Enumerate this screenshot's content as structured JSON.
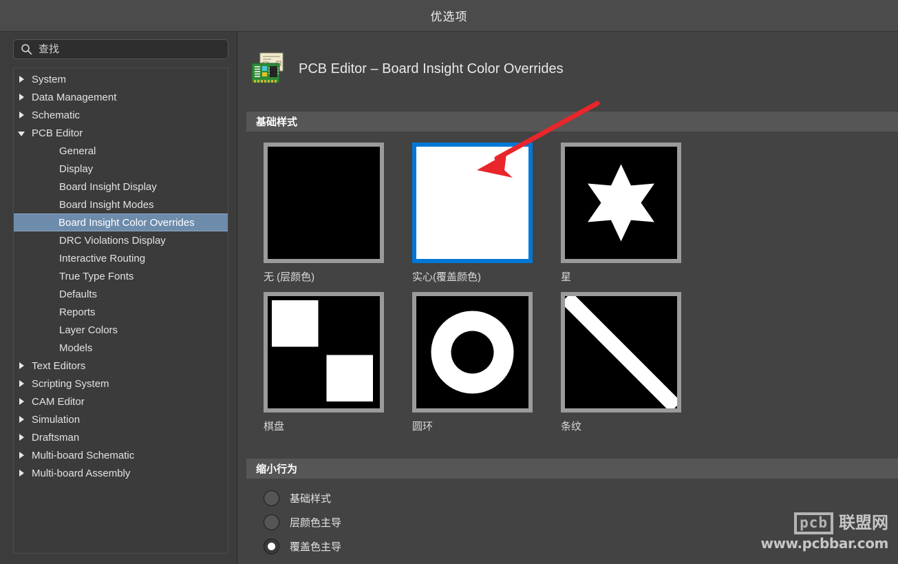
{
  "window": {
    "title": "优选项"
  },
  "search": {
    "icon": "search-icon",
    "value": "查找"
  },
  "sidebar": {
    "items": [
      {
        "label": "System",
        "level": 0,
        "expanded": false,
        "selected": false
      },
      {
        "label": "Data Management",
        "level": 0,
        "expanded": false,
        "selected": false
      },
      {
        "label": "Schematic",
        "level": 0,
        "expanded": false,
        "selected": false
      },
      {
        "label": "PCB Editor",
        "level": 0,
        "expanded": true,
        "selected": false
      },
      {
        "label": "General",
        "level": 1,
        "expanded": null,
        "selected": false
      },
      {
        "label": "Display",
        "level": 1,
        "expanded": null,
        "selected": false
      },
      {
        "label": "Board Insight Display",
        "level": 1,
        "expanded": null,
        "selected": false
      },
      {
        "label": "Board Insight Modes",
        "level": 1,
        "expanded": null,
        "selected": false
      },
      {
        "label": "Board Insight Color Overrides",
        "level": 1,
        "expanded": null,
        "selected": true
      },
      {
        "label": "DRC Violations Display",
        "level": 1,
        "expanded": null,
        "selected": false
      },
      {
        "label": "Interactive Routing",
        "level": 1,
        "expanded": null,
        "selected": false
      },
      {
        "label": "True Type Fonts",
        "level": 1,
        "expanded": null,
        "selected": false
      },
      {
        "label": "Defaults",
        "level": 1,
        "expanded": null,
        "selected": false
      },
      {
        "label": "Reports",
        "level": 1,
        "expanded": null,
        "selected": false
      },
      {
        "label": "Layer Colors",
        "level": 1,
        "expanded": null,
        "selected": false
      },
      {
        "label": "Models",
        "level": 1,
        "expanded": null,
        "selected": false
      },
      {
        "label": "Text Editors",
        "level": 0,
        "expanded": false,
        "selected": false
      },
      {
        "label": "Scripting System",
        "level": 0,
        "expanded": false,
        "selected": false
      },
      {
        "label": "CAM Editor",
        "level": 0,
        "expanded": false,
        "selected": false
      },
      {
        "label": "Simulation",
        "level": 0,
        "expanded": false,
        "selected": false
      },
      {
        "label": "Draftsman",
        "level": 0,
        "expanded": false,
        "selected": false
      },
      {
        "label": "Multi-board Schematic",
        "level": 0,
        "expanded": false,
        "selected": false
      },
      {
        "label": "Multi-board Assembly",
        "level": 0,
        "expanded": false,
        "selected": false
      }
    ]
  },
  "page": {
    "icon": "pcb-board-icon",
    "title": "PCB Editor – Board Insight Color Overrides"
  },
  "sections": {
    "basic_style": {
      "title": "基础样式"
    },
    "zoom_out_behavior": {
      "title": "缩小行为"
    }
  },
  "styles": [
    {
      "label": "无 (层颜色)",
      "pattern": "none",
      "selected": false
    },
    {
      "label": "实心(覆盖颜色)",
      "pattern": "solid",
      "selected": true
    },
    {
      "label": "星",
      "pattern": "star",
      "selected": false
    },
    {
      "label": "棋盘",
      "pattern": "checker",
      "selected": false
    },
    {
      "label": "圆环",
      "pattern": "ring",
      "selected": false
    },
    {
      "label": "条纹",
      "pattern": "stripe",
      "selected": false
    }
  ],
  "zoom_behavior": {
    "options": [
      {
        "label": "基础样式",
        "selected": false
      },
      {
        "label": "层颜色主导",
        "selected": false
      },
      {
        "label": "覆盖色主导",
        "selected": true
      }
    ]
  },
  "annotation": {
    "arrow_color": "#e8262b",
    "points_to": "实心(覆盖颜色)"
  },
  "watermark": {
    "logo_text": "pcb",
    "brand": "联盟网",
    "url": "www.pcbbar.com"
  },
  "colors": {
    "accent_selected": "#0078d7",
    "tree_selection": "#6d8bab",
    "section_bar": "#565656",
    "window_bg": "#434343",
    "sidebar_bg": "#3c3c3c",
    "tile_border": "#9b9b9b",
    "annotation_red": "#e8262b"
  }
}
